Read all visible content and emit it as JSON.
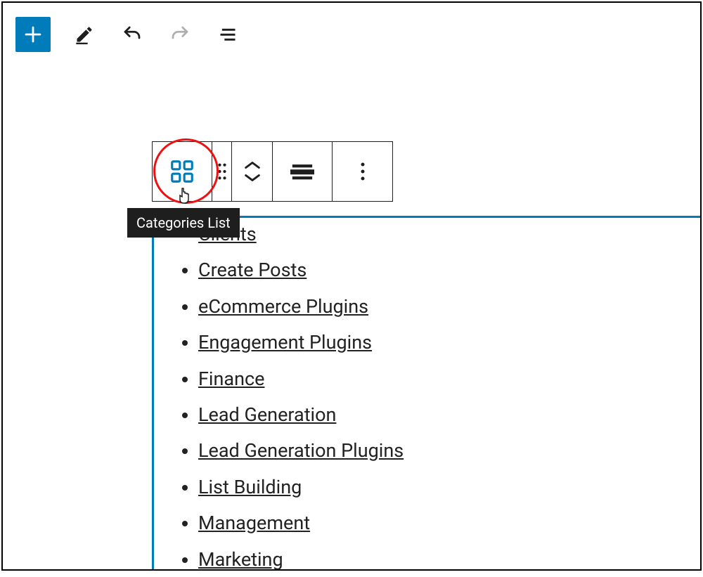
{
  "toolbar": {
    "add_icon": "plus",
    "edit_icon": "pencil",
    "undo_icon": "arrow-undo",
    "redo_icon": "arrow-redo",
    "outline_icon": "list-outline"
  },
  "block_toolbar": {
    "type_icon": "categories-grid",
    "drag_icon": "drag-handle",
    "move_up_icon": "chevron-up",
    "move_down_icon": "chevron-down",
    "align_icon": "align-wide",
    "more_icon": "more-vertical"
  },
  "tooltip": {
    "text": "Categories List"
  },
  "categories_block": {
    "items": [
      {
        "label": "Clients"
      },
      {
        "label": "Create Posts"
      },
      {
        "label": "eCommerce Plugins"
      },
      {
        "label": "Engagement Plugins"
      },
      {
        "label": "Finance"
      },
      {
        "label": "Lead Generation"
      },
      {
        "label": "Lead Generation Plugins"
      },
      {
        "label": "List Building"
      },
      {
        "label": "Management"
      },
      {
        "label": "Marketing"
      }
    ]
  },
  "colors": {
    "accent": "#007cba",
    "annotation": "#e11"
  }
}
